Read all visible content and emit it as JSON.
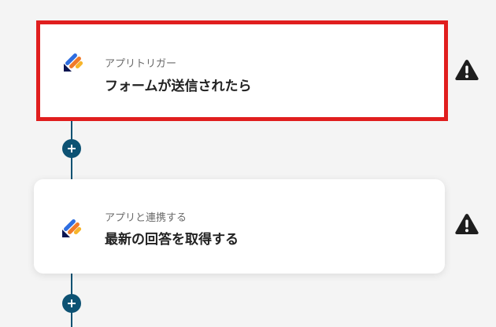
{
  "flow": {
    "steps": [
      {
        "type_label": "アプリトリガー",
        "title": "フォームが送信されたら",
        "icon": "jotform-app-icon",
        "status_icon": "warning-icon",
        "selected": true
      },
      {
        "type_label": "アプリと連携する",
        "title": "最新の回答を取得する",
        "icon": "jotform-app-icon",
        "status_icon": "warning-icon",
        "selected": false
      }
    ],
    "add_step_icon": "plus-icon"
  },
  "colors": {
    "selection_border": "#e01e1e",
    "connector": "#0d5273",
    "warning": "#1e1e1e",
    "background": "#f4f4f4",
    "card": "#ffffff",
    "logo_blue": "#2f6ee0",
    "logo_orange": "#f07a2a",
    "logo_yellow": "#f7b52c",
    "logo_navy": "#0a1551"
  }
}
